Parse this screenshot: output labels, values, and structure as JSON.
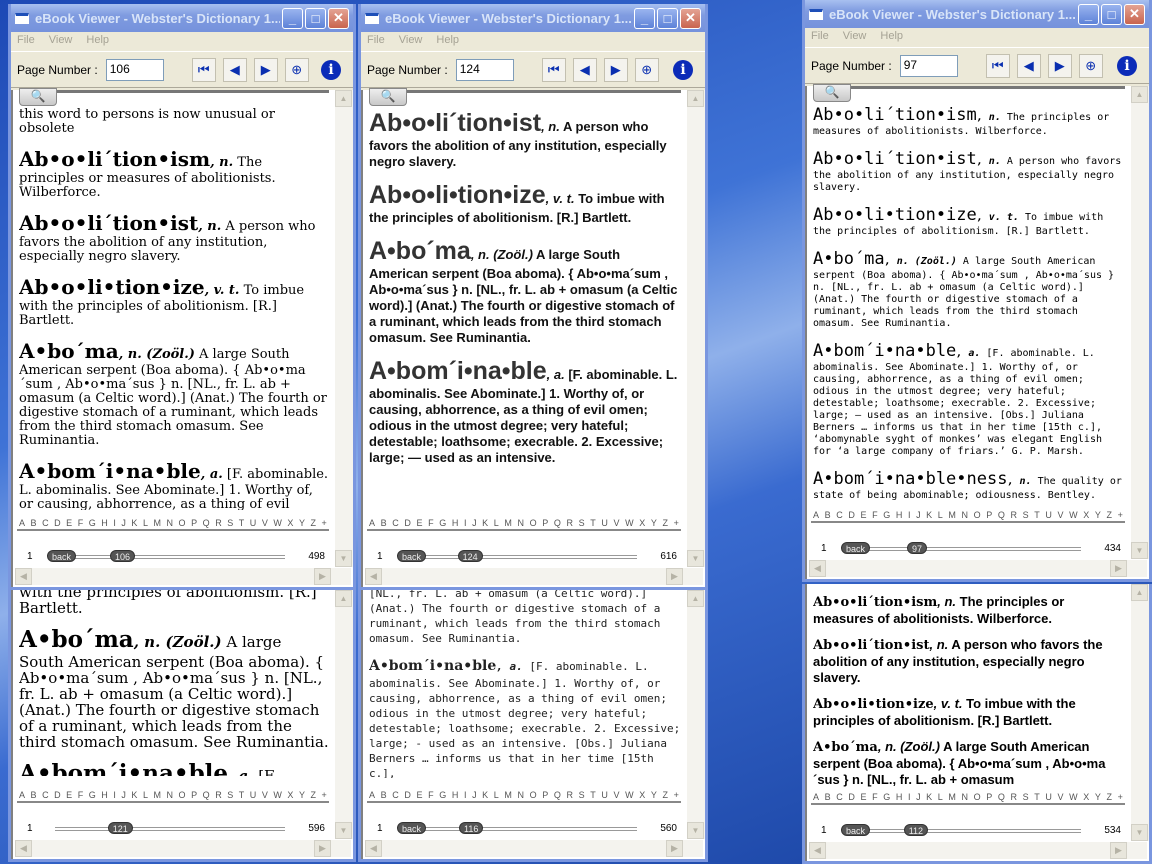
{
  "app": {
    "title": "eBook Viewer - Webster's Dictionary 1...",
    "menu": [
      "File",
      "View",
      "Help"
    ],
    "page_label": "Page Number :",
    "toolbar_icons": [
      "first-page-icon",
      "previous-page-icon",
      "next-page-icon",
      "zoom-icon",
      "info-icon"
    ],
    "alphabet": [
      "A",
      "B",
      "C",
      "D",
      "E",
      "F",
      "G",
      "H",
      "I",
      "J",
      "K",
      "L",
      "M",
      "N",
      "O",
      "P",
      "Q",
      "R",
      "S",
      "T",
      "U",
      "V",
      "W",
      "X",
      "Y",
      "Z",
      "+"
    ],
    "back_label": "back",
    "slider_min": "1",
    "accent": "#7a96df"
  },
  "windows": [
    {
      "id": "a",
      "font": "f-serif",
      "has_title": true,
      "page": 106,
      "total": 498,
      "has_back": true,
      "intro": "this word to persons is now unusual or obsolete",
      "entries": [
        {
          "hw": "Ab•o•li´tion•ism",
          "pos": ", n.",
          "body": " The principles or measures of abolitionists. Wilberforce."
        },
        {
          "hw": "Ab•o•li´tion•ist",
          "pos": ", n.",
          "body": " A person who favors the abolition of any institution, especially negro slavery."
        },
        {
          "hw": "Ab•o•li•tion•ize",
          "pos": ", v. t.",
          "body": " To imbue with the principles of abolitionism. [R.] Bartlett."
        },
        {
          "hw": "A•bo´ma",
          "pos": ", n. (Zoöl.)",
          "body": " A large South American serpent (Boa aboma). { Ab•o•ma´sum , Ab•o•ma´sus } n. [NL., fr. L. ab + omasum (a Celtic word).] (Anat.) The fourth or digestive stomach of a ruminant, which leads from the third stomach omasum. See Ruminantia."
        },
        {
          "hw": "A•bom´i•na•ble",
          "pos": ", a.",
          "body": " [F. abominable. L. abominalis. See Abominate.] 1. Worthy of, or causing, abhorrence, as a thing of evil omen; odious in the utmost degree; very hateful; detestable; loathsome; execrable. 2. Excessive; large; — used as an intensive. [Obs.] Juliana"
        }
      ]
    },
    {
      "id": "b",
      "font": "f-sans",
      "has_title": true,
      "page": 124,
      "total": 616,
      "has_back": true,
      "intro": "",
      "entries": [
        {
          "hw": "Ab•o•li´tion•ist",
          "pos": ", n.",
          "body": " A person who favors the abolition of any institution, especially negro slavery."
        },
        {
          "hw": "Ab•o•li•tion•ize",
          "pos": ", v. t.",
          "body": " To imbue with the principles of abolitionism. [R.] Bartlett."
        },
        {
          "hw": "A•bo´ma",
          "pos": ", n. (Zoöl.)",
          "body": " A large South American serpent (Boa aboma). { Ab•o•ma´sum , Ab•o•ma´sus } n. [NL., fr. L. ab + omasum (a Celtic word).] (Anat.) The fourth or digestive stomach of a ruminant, which leads from the third stomach omasum. See Ruminantia."
        },
        {
          "hw": "A•bom´i•na•ble",
          "pos": ", a.",
          "body": " [F. abominable. L. abominalis. See Abominate.] 1. Worthy of, or causing, abhorrence, as a thing of evil omen; odious in the utmost degree; very hateful; detestable; loathsome; execrable. 2. Excessive; large; — used as an intensive."
        }
      ]
    },
    {
      "id": "c",
      "font": "f-mono",
      "has_title": true,
      "page": 97,
      "total": 434,
      "has_back": true,
      "intro": "",
      "entries": [
        {
          "hw": "Ab•o•li´tion•ism",
          "pos": ", n.",
          "body": " The principles or measures of abolitionists. Wilberforce."
        },
        {
          "hw": "Ab•o•li´tion•ist",
          "pos": ", n.",
          "body": " A person who favors the abolition of any institution, especially negro slavery."
        },
        {
          "hw": "Ab•o•li•tion•ize",
          "pos": ", v. t.",
          "body": " To imbue with the principles of abolitionism. [R.] Bartlett."
        },
        {
          "hw": "A•bo´ma",
          "pos": ", n. (Zoöl.)",
          "body": " A large South American serpent (Boa aboma). { Ab•o•ma´sum , Ab•o•ma´sus } n. [NL., fr. L. ab + omasum (a Celtic word).] (Anat.) The fourth or digestive stomach of a ruminant, which leads from the third stomach omasum. See Ruminantia."
        },
        {
          "hw": "A•bom´i•na•ble",
          "pos": ", a.",
          "body": " [F. abominable. L. abominalis. See Abominate.] 1. Worthy of, or causing, abhorrence, as a thing of evil omen; odious in the utmost degree; very hateful; detestable; loathsome; execrable. 2. Excessive; large; — used as an intensive. [Obs.] Juliana Berners … informs us that in her time [15th c.], ‘abomynable syght of monkes’ was elegant English for ‘a large company of friars.’ G. P. Marsh."
        },
        {
          "hw": "A•bom´i•na•ble•ness",
          "pos": ", n.",
          "body": " The quality or state of being abominable; odiousness. Bentley."
        }
      ]
    },
    {
      "id": "d",
      "font": "f-serif-lg",
      "has_title": false,
      "page": 121,
      "total": 596,
      "has_back": false,
      "intro": "with the principles of abolitionism. [R.] Bartlett.",
      "entries": [
        {
          "hw": "A•bo´ma",
          "pos": ", n. (Zoöl.)",
          "body": " A large South American serpent (Boa aboma). { Ab•o•ma´sum , Ab•o•ma´sus } n. [NL., fr. L. ab + omasum (a Celtic word).] (Anat.) The fourth or digestive stomach of a ruminant, which leads from the third stomach omasum. See Ruminantia."
        },
        {
          "hw": "A•bom´i•na•ble",
          "pos": ", a.",
          "body": " [F. abominable. L. abominalis. See"
        }
      ]
    },
    {
      "id": "e",
      "font": "f-mono2",
      "has_title": false,
      "page": 116,
      "total": 560,
      "has_back": true,
      "intro": "[NL., fr. L. ab + omasum (a Celtic word).] (Anat.) The fourth or digestive stomach of a ruminant, which leads from the third stomach omasum. See Ruminantia.",
      "entries": [
        {
          "hw": "A•bom´i•na•ble",
          "pos": ", a.",
          "body": " [F. abominable. L. abominalis. See Abominate.] 1. Worthy of, or causing, abhorrence, as a thing of evil omen; odious in the utmost degree; very hateful; detestable; loathsome; execrable. 2. Excessive; large; - used as an intensive. [Obs.] Juliana Berners … informs us that in her time [15th c.],"
        }
      ]
    },
    {
      "id": "f",
      "font": "f-sans2",
      "has_title": false,
      "page": 112,
      "total": 534,
      "has_back": true,
      "intro": "",
      "entries": [
        {
          "hw": "Ab•o•li´tion•ism",
          "pos": ", n.",
          "body": " The principles or measures of abolitionists. Wilberforce."
        },
        {
          "hw": "Ab•o•li´tion•ist",
          "pos": ", n.",
          "body": " A person who favors the abolition of any institution, especially negro slavery."
        },
        {
          "hw": "Ab•o•li•tion•ize",
          "pos": ", v. t.",
          "body": " To imbue with the principles of abolitionism. [R.] Bartlett."
        },
        {
          "hw": "A•bo´ma",
          "pos": ", n. (Zoöl.)",
          "body": " A large South American serpent (Boa aboma). { Ab•o•ma´sum , Ab•o•ma´sus } n. [NL., fr. L. ab + omasum"
        }
      ]
    }
  ]
}
